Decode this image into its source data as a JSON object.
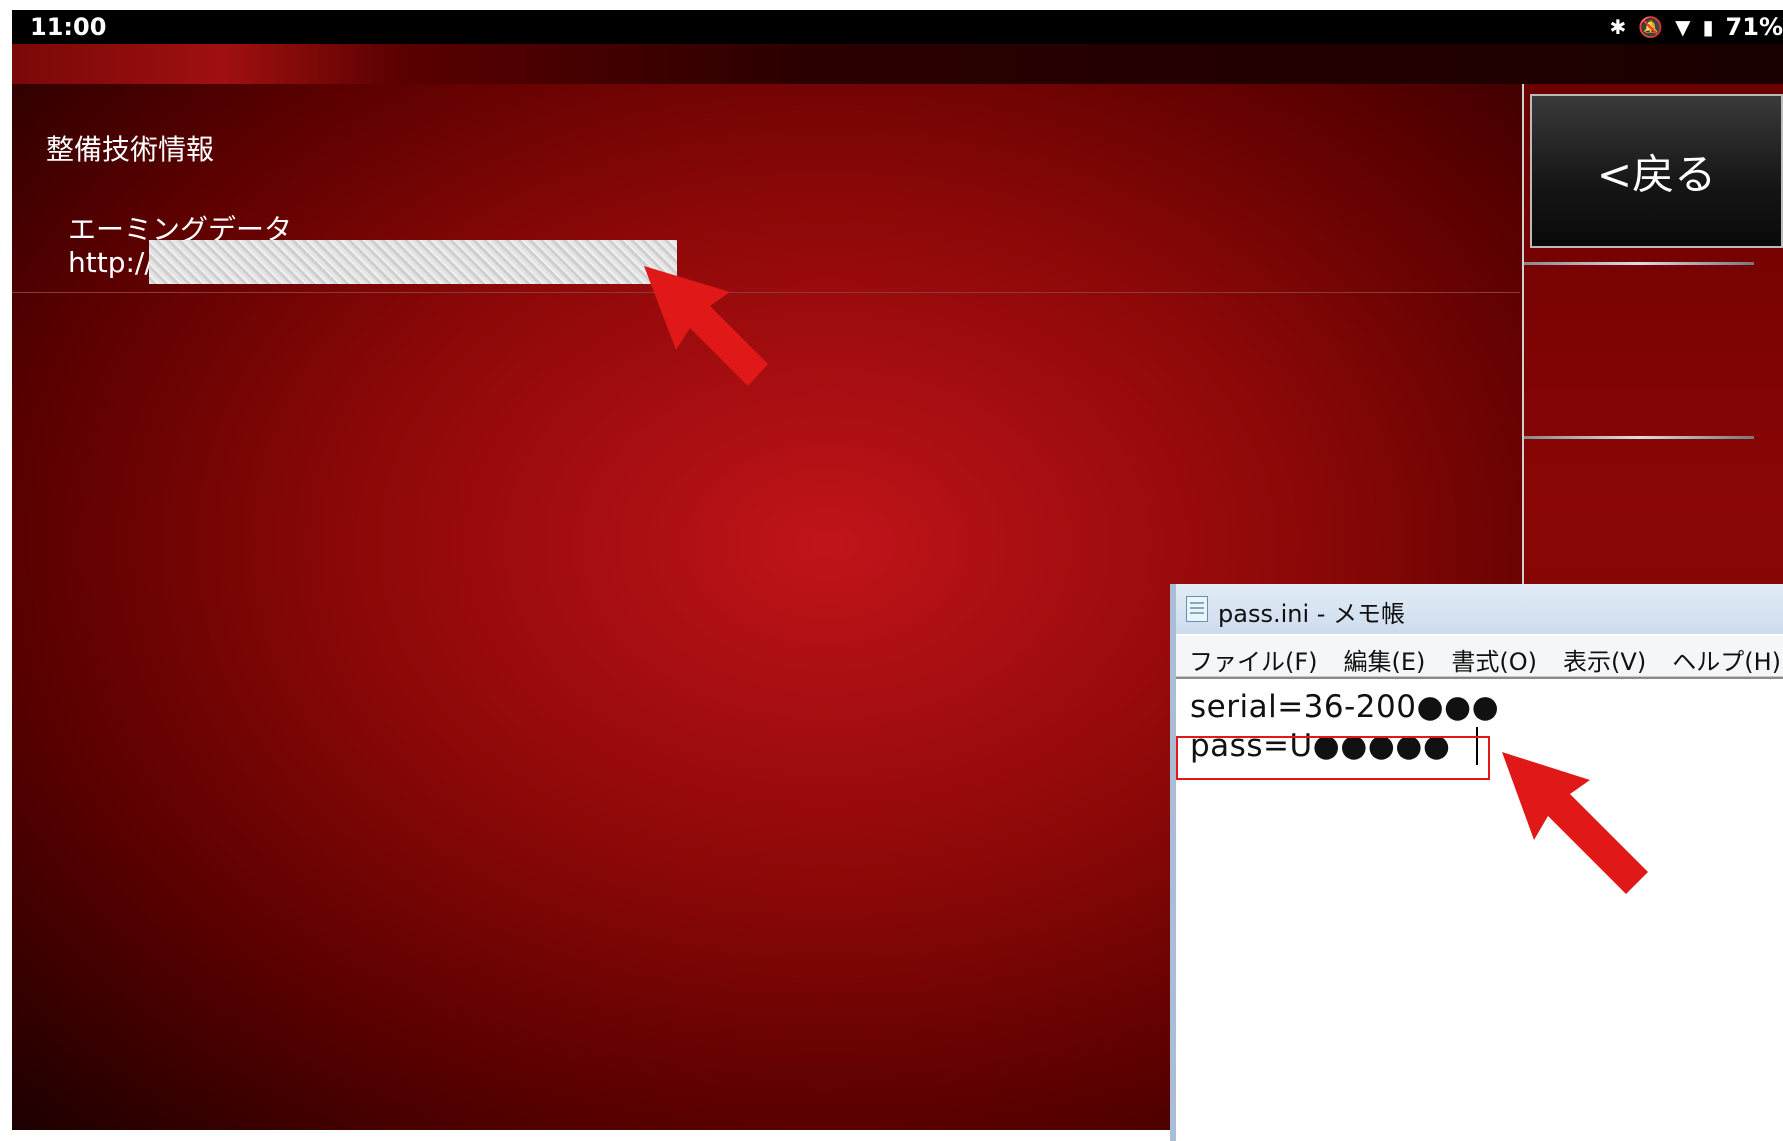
{
  "status_bar": {
    "time": "11:00",
    "battery": "71%",
    "icons": [
      "bluetooth-icon",
      "mute-icon",
      "wifi-icon",
      "battery-icon"
    ]
  },
  "main": {
    "section_title": "整備技術情報",
    "entry": {
      "title": "エーミングデータ",
      "url": "http://"
    }
  },
  "right_panel": {
    "back_label": "<戻る"
  },
  "notepad": {
    "title": "pass.ini - メモ帳",
    "menu": [
      "ファイル(F)",
      "編集(E)",
      "書式(O)",
      "表示(V)",
      "ヘルプ(H)"
    ],
    "lines": [
      "serial=36-200●●●",
      "pass=U●●●●●"
    ]
  },
  "colors": {
    "annotation": "#e01818",
    "main_red": "#c0141a"
  }
}
